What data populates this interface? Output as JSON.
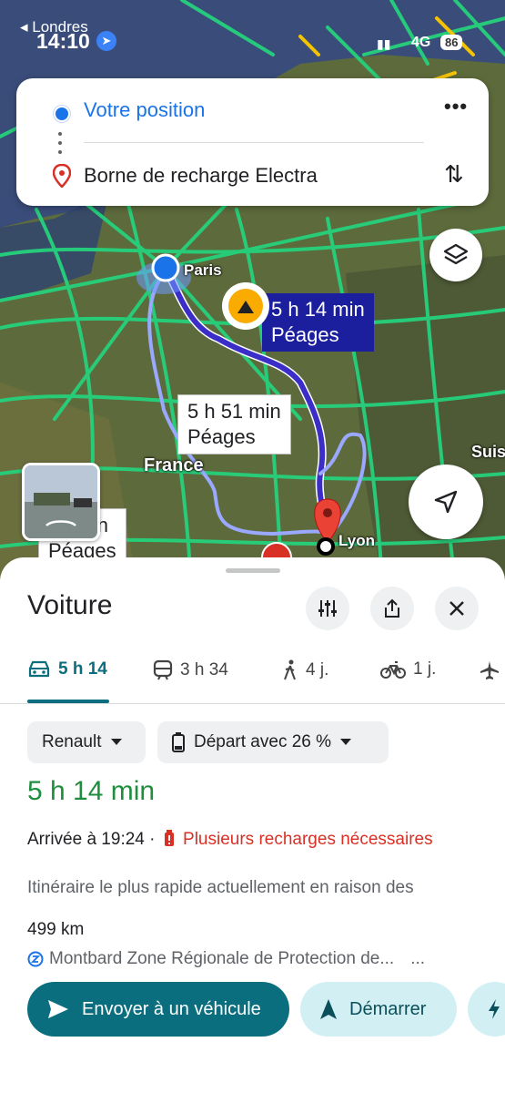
{
  "status": {
    "back_label": "◂ Londres",
    "time": "14:10",
    "network": "4G",
    "battery": "86"
  },
  "search": {
    "origin": "Votre position",
    "destination": "Borne de recharge Electra"
  },
  "map": {
    "cities": {
      "paris": "Paris",
      "france": "France",
      "lyon": "Lyon",
      "suisse": "Suis"
    },
    "routes": [
      {
        "time": "5 h 14 min",
        "tolls": "Péages",
        "selected": true
      },
      {
        "time": "5 h 51 min",
        "tolls": "Péages",
        "selected": false
      },
      {
        "time": "5 h 57 min",
        "time_visible": "57 min",
        "tolls": "Péages",
        "selected": false
      }
    ],
    "colors": {
      "route": "#3b2ec8",
      "traffic_free": "#25d17c",
      "traffic_slow": "#f5c400"
    }
  },
  "sheet": {
    "title": "Voiture",
    "modes": [
      {
        "icon": "car-icon",
        "label": "5 h 14",
        "active": true
      },
      {
        "icon": "train-icon",
        "label": "3 h 34",
        "active": false
      },
      {
        "icon": "walk-icon",
        "label": "4 j.",
        "active": false
      },
      {
        "icon": "bike-icon",
        "label": "1 j.",
        "active": false
      },
      {
        "icon": "plane-icon",
        "label": "",
        "active": false
      }
    ],
    "vehicle": "Renault",
    "charge": "Départ avec 26 %",
    "duration": "5 h 14 min",
    "arrival": "Arrivée à 19:24 ·",
    "charge_warning": "Plusieurs recharges nécessaires",
    "reason": "Itinéraire le plus rapide actuellement en raison des",
    "distance": "499 km",
    "zone": "Montbard Zone Régionale de Protection de...",
    "zone_more": "...",
    "send_label": "Envoyer à un véhicule",
    "start_label": "Démarrer"
  }
}
